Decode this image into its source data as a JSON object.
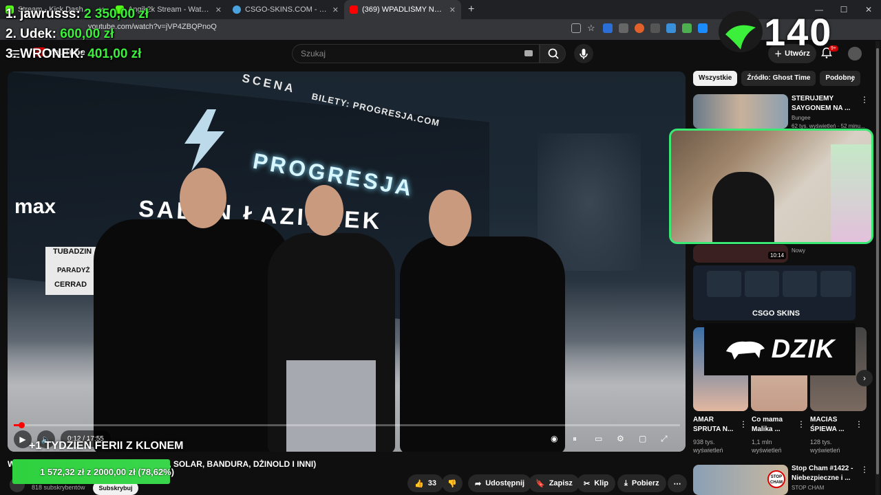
{
  "browser": {
    "tabs": [
      {
        "title": "Stream - Kick Dashboard",
        "color": "#53fc18"
      },
      {
        "title": "Angik2k Stream - Watch Live o",
        "color": "#53fc18"
      },
      {
        "title": "CSGO-SKINS.COM - Najlepsze",
        "color": "#4aa3df"
      },
      {
        "title": "(369) WPADLIŚMY NA BUNGEE",
        "color": "#ff0000"
      }
    ],
    "new_tab": "+",
    "url": "youtube.com/watch?v=jVP4ZBQPnoQ"
  },
  "leaderboard": [
    {
      "rank_name": "1. jawrusss:",
      "amount": "2 350,00 zł"
    },
    {
      "rank_name": "2. Udek:",
      "amount": "600,00 zł"
    },
    {
      "rank_name": "3. WRONEK:",
      "amount": "401,00 zł"
    }
  ],
  "counter": "140",
  "youtube": {
    "logo": "YouTube",
    "search_placeholder": "Szukaj",
    "create_label": "Utwórz",
    "notif_badge": "9+"
  },
  "video": {
    "sign_scena": "SCENA",
    "sign_bilety": "BILETY: PROGRESJA.COM",
    "sign_progresja": "PROGRESJA",
    "sign_salon": "SALON ŁAZIENEK",
    "sign_max": "max",
    "sign_tubadzin": "TUBADZIN",
    "sign_paradyz": "PARADYŻ",
    "sign_cerrad": "CERRAD",
    "time": "0:12 / 17:55",
    "progress": 0.011,
    "chapter": "+1 TYDZIEŃ FERII Z KLONEM",
    "title": "WPADLIŚMY NA BUNGEE TOUR (BLAMS, SOLAR, BANDURA, DŻINOLD I INNI)"
  },
  "goal": {
    "text": "1 572,32 zł z 2000,00 zł (78,62%)",
    "progress": 0.7862
  },
  "channel": {
    "subs": "818 subskrybentów",
    "subscribe": "Subskrybuj"
  },
  "actions": {
    "likes": "33",
    "share": "Udostępnij",
    "save": "Zapisz",
    "clip": "Klip",
    "download": "Pobierz"
  },
  "sidebar": {
    "chips": [
      "Wszystkie",
      "Źródło: Ghost Time",
      "Podobne"
    ],
    "rec1": {
      "title": "STERUJEMY SAYGONEM NA ...",
      "channel": "Bungee",
      "meta": "62 tys. wyświetleń · 52 minu..."
    },
    "rec2": {
      "duration": "10:14",
      "badge": "Nowy"
    },
    "csgo_label": "CSGO SKINS",
    "dzik_label": "DZIK",
    "shorts": [
      {
        "title": "AMAR SPRUTA N...",
        "views": "938 tys. wyświetleń"
      },
      {
        "title": "Co mama Malika ...",
        "views": "1,1 mln wyświetleń"
      },
      {
        "title": "MACIAS ŚPIEWA ...",
        "views": "128 tys. wyświetleń"
      }
    ],
    "rec3": {
      "title": "Stop Cham #1422 - Niebezpieczne i ...",
      "channel": "STOP CHAM",
      "thumb_text": "STOP CHAM"
    }
  }
}
